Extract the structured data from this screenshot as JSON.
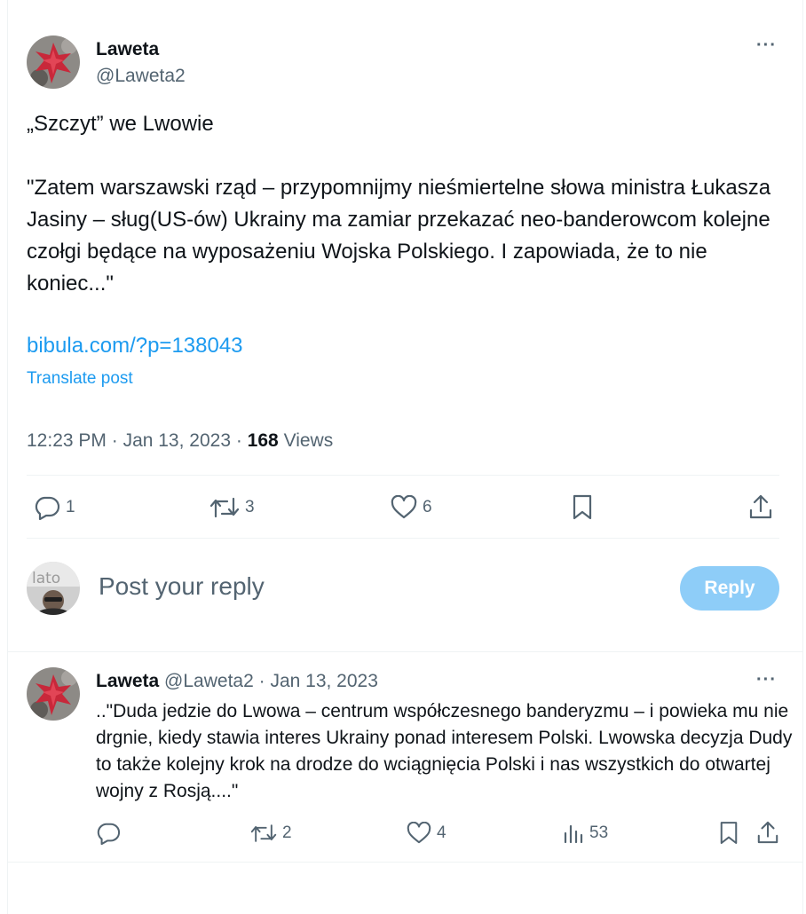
{
  "main_tweet": {
    "author_name": "Laweta",
    "author_handle": "@Laweta2",
    "more_label": "···",
    "text_line1": "„Szczyt” we Lwowie",
    "text_para2": "\"Zatem warszawski rząd – przypomnijmy nieśmiertelne słowa ministra Łukasza Jasiny – sług(US-ów) Ukrainy ma zamiar przekazać neo-banderowcom kolejne czołgi będące na wyposażeniu Wojska Polskiego. I zapowiada, że to nie koniec...\"",
    "link": "bibula.com/?p=138043",
    "translate_label": "Translate post",
    "time": "12:23 PM",
    "date": "Jan 13, 2023",
    "views_count": "168",
    "views_label": "Views",
    "replies": "1",
    "reposts": "3",
    "likes": "6"
  },
  "composer": {
    "placeholder": "Post your reply",
    "reply_button": "Reply"
  },
  "reply_tweet": {
    "author_name": "Laweta",
    "author_handle": "@Laweta2",
    "date": "Jan 13, 2023",
    "more_label": "···",
    "text": "..\"Duda jedzie do Lwowa – centrum współczesnego banderyzmu – i powieka mu nie drgnie, kiedy stawia interes Ukrainy ponad interesem Polski. Lwowska decyzja Dudy to także kolejny krok na drodze do wciągnięcia Polski i nas wszystkich do otwartej wojny z Rosją....\"",
    "replies": "",
    "reposts": "2",
    "likes": "4",
    "views": "53"
  },
  "colors": {
    "accent": "#1d9bf0",
    "text_primary": "#0f1419",
    "text_secondary": "#536471",
    "reply_button_disabled": "#8ecdf8",
    "divider": "#eff3f4"
  },
  "icons": {
    "reply": "speech-bubble-icon",
    "repost": "repost-arrows-icon",
    "like": "heart-icon",
    "bookmark": "bookmark-icon",
    "share": "share-upload-icon",
    "views": "bar-chart-icon",
    "more": "ellipsis-icon"
  }
}
